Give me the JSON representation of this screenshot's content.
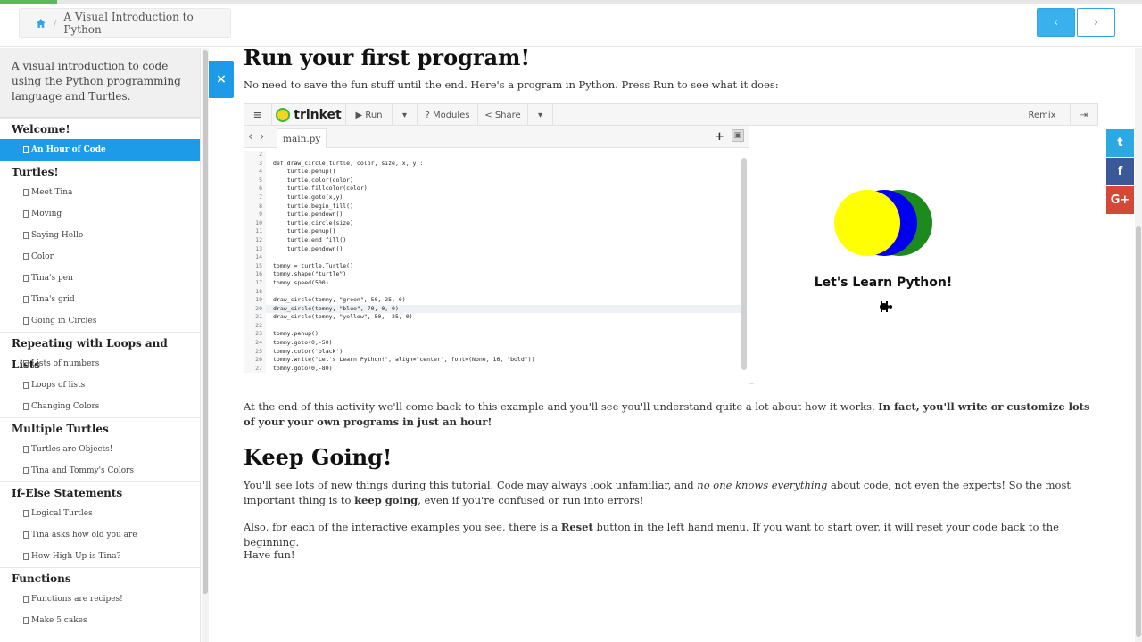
{
  "progress": {
    "fraction": 0.05,
    "color": "#5cb85c"
  },
  "breadcrumb": {
    "home_icon": "home-icon",
    "separator": "/",
    "title": "A Visual Introduction to Python"
  },
  "nav": {
    "prev": "‹",
    "next": "›"
  },
  "sidebar": {
    "intro": "A visual introduction to code using the Python programming language and Turtles.",
    "sections": [
      {
        "title": "Welcome!",
        "items": [
          {
            "label": "An Hour of Code",
            "active": true
          }
        ]
      },
      {
        "title": "Turtles!",
        "items": [
          {
            "label": "Meet Tina"
          },
          {
            "label": "Moving"
          },
          {
            "label": "Saying Hello"
          },
          {
            "label": "Color"
          },
          {
            "label": "Tina's pen"
          },
          {
            "label": "Tina's grid"
          },
          {
            "label": "Going in Circles"
          }
        ]
      },
      {
        "title": "Repeating with Loops and Lists",
        "items": [
          {
            "label": "Lists of numbers"
          },
          {
            "label": "Loops of lists"
          },
          {
            "label": "Changing Colors"
          }
        ]
      },
      {
        "title": "Multiple Turtles",
        "items": [
          {
            "label": "Turtles are Objects!"
          },
          {
            "label": "Tina and Tommy's Colors"
          }
        ]
      },
      {
        "title": "If-Else Statements",
        "items": [
          {
            "label": "Logical Turtles"
          },
          {
            "label": "Tina asks how old you are"
          },
          {
            "label": "How High Up is Tina?"
          }
        ]
      },
      {
        "title": "Functions",
        "items": [
          {
            "label": "Functions are recipes!"
          },
          {
            "label": "Make 5 cakes"
          }
        ]
      }
    ]
  },
  "close_tab": "×",
  "main": {
    "heading1": "Run your first program!",
    "intro": "No need to save the fun stuff until the end. Here's a program in Python. Press Run to see what it does:",
    "after_text_normal": "At the end of this activity we'll come back to this example and you'll see you'll understand quite a lot about how it works. ",
    "after_text_bold": "In fact, you'll write or customize lots of your your own programs in just an hour!",
    "heading2": "Keep Going!",
    "p1_a": "You'll see lots of new things during this tutorial. Code may always look unfamiliar, and ",
    "p1_em": "no one knows everything",
    "p1_b": " about code, not even the experts! So the most important thing is to ",
    "p1_strong": "keep going",
    "p1_c": ", even if you're confused or run into errors!",
    "p2_a": "Also, for each of the interactive examples you see, there is a ",
    "p2_strong": "Reset",
    "p2_b": " button in the left hand menu. If you want to start over, it will reset your code back to the beginning.",
    "p3": "Have fun!"
  },
  "trinket": {
    "menu_icon": "≡",
    "logo": "trinket",
    "run": "▶ Run",
    "run_menu": "▾",
    "modules": "? Modules",
    "share": "< Share",
    "share_menu": "▾",
    "remix": "Remix",
    "login_icon": "⇥",
    "file_tab": "main.py",
    "nav_prev": "‹",
    "nav_next": "›",
    "add_file": "+",
    "upload_icon": "▣",
    "code_lines": [
      {
        "n": "2",
        "t": ""
      },
      {
        "n": "3",
        "t": "def draw_circle(turtle, color, size, x, y):"
      },
      {
        "n": "4",
        "t": "    turtle.penup()"
      },
      {
        "n": "5",
        "t": "    turtle.color(color)"
      },
      {
        "n": "6",
        "t": "    turtle.fillcolor(color)"
      },
      {
        "n": "7",
        "t": "    turtle.goto(x,y)"
      },
      {
        "n": "8",
        "t": "    turtle.begin_fill()"
      },
      {
        "n": "9",
        "t": "    turtle.pendown()"
      },
      {
        "n": "10",
        "t": "    turtle.circle(size)"
      },
      {
        "n": "11",
        "t": "    turtle.penup()"
      },
      {
        "n": "12",
        "t": "    turtle.end_fill()"
      },
      {
        "n": "13",
        "t": "    turtle.pendown()"
      },
      {
        "n": "14",
        "t": ""
      },
      {
        "n": "15",
        "t": "tommy = turtle.Turtle()"
      },
      {
        "n": "16",
        "t": "tommy.shape(\"turtle\")"
      },
      {
        "n": "17",
        "t": "tommy.speed(500)"
      },
      {
        "n": "18",
        "t": ""
      },
      {
        "n": "19",
        "t": "draw_circle(tommy, \"green\", 50, 25, 0)"
      },
      {
        "n": "20",
        "t": "draw_circle(tommy, \"blue\", 70, 0, 0)",
        "current": true
      },
      {
        "n": "21",
        "t": "draw_circle(tommy, \"yellow\", 50, -25, 0)"
      },
      {
        "n": "22",
        "t": ""
      },
      {
        "n": "23",
        "t": "tommy.penup()"
      },
      {
        "n": "24",
        "t": "tommy.goto(0,-50)"
      },
      {
        "n": "25",
        "t": "tommy.color('black')"
      },
      {
        "n": "26",
        "t": "tommy.write(\"Let's Learn Python!\", align=\"center\", font=(None, 16, \"bold\"))"
      },
      {
        "n": "27",
        "t": "tommy.goto(0,-80)"
      }
    ],
    "output_caption": "Let's Learn Python!",
    "circle_colors": {
      "green": "#1c8a1c",
      "blue": "#0000ee",
      "yellow": "#ffff00"
    }
  },
  "social": {
    "twitter": "t",
    "facebook": "f",
    "google": "G+"
  },
  "colors": {
    "accent": "#1e9be8"
  }
}
